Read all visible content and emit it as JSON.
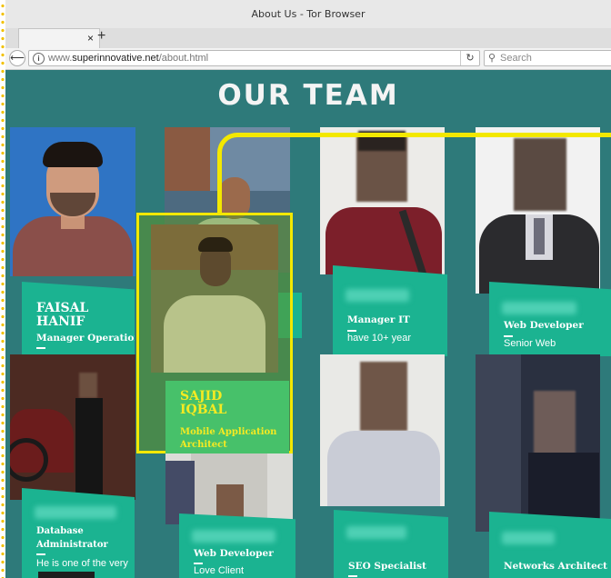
{
  "window": {
    "title": "About Us - Tor Browser"
  },
  "tabs": {
    "close_glyph": "×",
    "new_tab_glyph": "+"
  },
  "nav": {
    "back_glyph": "⟵",
    "info_glyph": "i",
    "url_prefix": "www.",
    "url_domain": "superinnovative.net",
    "url_path": "/about.html",
    "reload_glyph": "↻",
    "search_placeholder": "Search",
    "search_glyph": "⚲"
  },
  "page": {
    "heading": "OUR TEAM",
    "team": [
      {
        "name_line1": "FAISAL",
        "name_line2": "HANIF",
        "role": "Manager Operation"
      },
      {
        "name_line1": "SAJID",
        "name_line2": "IQBAL",
        "role": "Mobile Application Architect"
      },
      {
        "role": "Manager IT",
        "desc": "have 10+ year"
      },
      {
        "role": "Web Developer",
        "desc": "Senior Web"
      },
      {
        "role": "Database Administrator",
        "desc": "He is one of the very"
      },
      {
        "role": "Web Developer",
        "desc": "Love Client"
      },
      {
        "role": "SEO Specialist"
      },
      {
        "role": "Networks Architect"
      }
    ]
  },
  "colors": {
    "page_bg": "#2e7a7a",
    "card": "#1bb391",
    "highlight": "#f3e800",
    "drag_card": "#47c16a"
  }
}
